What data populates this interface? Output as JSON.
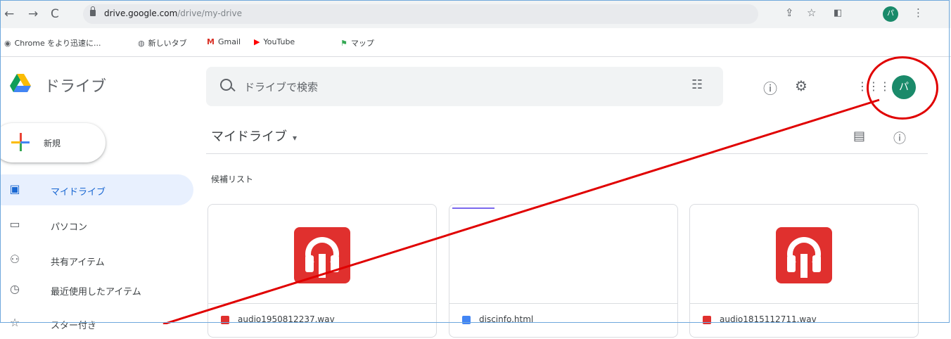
{
  "browser": {
    "url_host": "drive.google.com",
    "url_path": "/drive/my-drive",
    "profile_initial": "パ"
  },
  "bookmarks": [
    {
      "label": "Chrome をより迅速に...",
      "icon": "chrome-icon"
    },
    {
      "label": "新しいタブ",
      "icon": "globe-icon"
    },
    {
      "label": "Gmail",
      "icon": "gmail-icon"
    },
    {
      "label": "YouTube",
      "icon": "youtube-icon"
    },
    {
      "label": "マップ",
      "icon": "maps-icon"
    }
  ],
  "header": {
    "brand": "ドライブ",
    "search_placeholder": "ドライブで検索",
    "avatar_initial": "パ"
  },
  "sidebar": {
    "new_label": "新規",
    "items": [
      {
        "label": "マイドライブ",
        "icon": "my-drive-icon",
        "active": true
      },
      {
        "label": "パソコン",
        "icon": "computer-icon",
        "active": false
      },
      {
        "label": "共有アイテム",
        "icon": "shared-icon",
        "active": false
      },
      {
        "label": "最近使用したアイテム",
        "icon": "clock-icon",
        "active": false
      },
      {
        "label": "スター付き",
        "icon": "star-icon",
        "active": false
      }
    ]
  },
  "main": {
    "title": "マイドライブ",
    "section_label": "候補リスト",
    "files": [
      {
        "name": "audio1950812237.wav",
        "type": "audio"
      },
      {
        "name": "discinfo.html",
        "type": "html"
      },
      {
        "name": "audio1815112711.wav",
        "type": "audio"
      }
    ]
  },
  "colors": {
    "annotation": "#e00000",
    "avatar": "#1a8a6a",
    "audio_icon": "#e0302e",
    "active_nav_bg": "#e8f0fe"
  }
}
